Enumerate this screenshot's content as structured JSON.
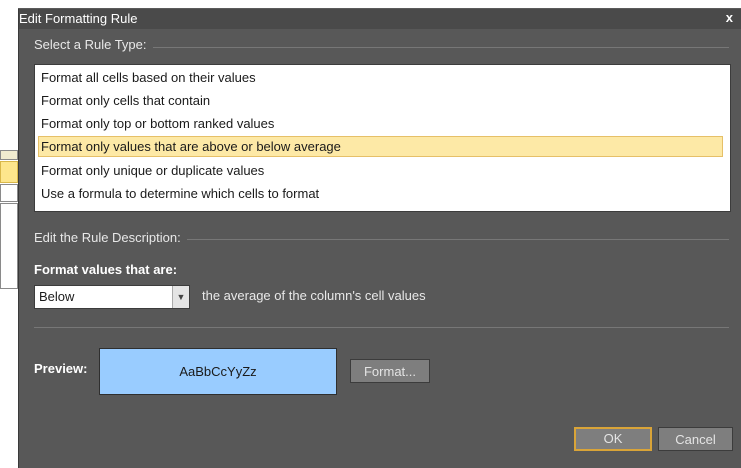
{
  "window": {
    "title": "Edit Formatting Rule",
    "close_glyph": "x"
  },
  "rule_type": {
    "group_label": "Select a Rule Type:",
    "items": [
      {
        "label": "Format all cells based on their values"
      },
      {
        "label": "Format only cells that contain"
      },
      {
        "label": "Format only top or bottom ranked values"
      },
      {
        "label": "Format only values that are above or below average",
        "selected": true
      },
      {
        "label": "Format only unique or duplicate values"
      },
      {
        "label": "Use a formula to determine which cells to format"
      }
    ]
  },
  "description": {
    "group_label": "Edit the Rule Description:",
    "heading": "Format values that are:",
    "combo_value": "Below",
    "after_text": "the average of the column's cell values"
  },
  "preview": {
    "label": "Preview:",
    "sample_text": "AaBbCcYyZz",
    "sample_color": "#99ccff",
    "format_button": "Format..."
  },
  "footer": {
    "ok_label": "OK",
    "cancel_label": "Cancel"
  },
  "colors": {
    "dialog_bg": "#585858",
    "selection": "#fde9a6",
    "ok_border": "#d9a438"
  }
}
